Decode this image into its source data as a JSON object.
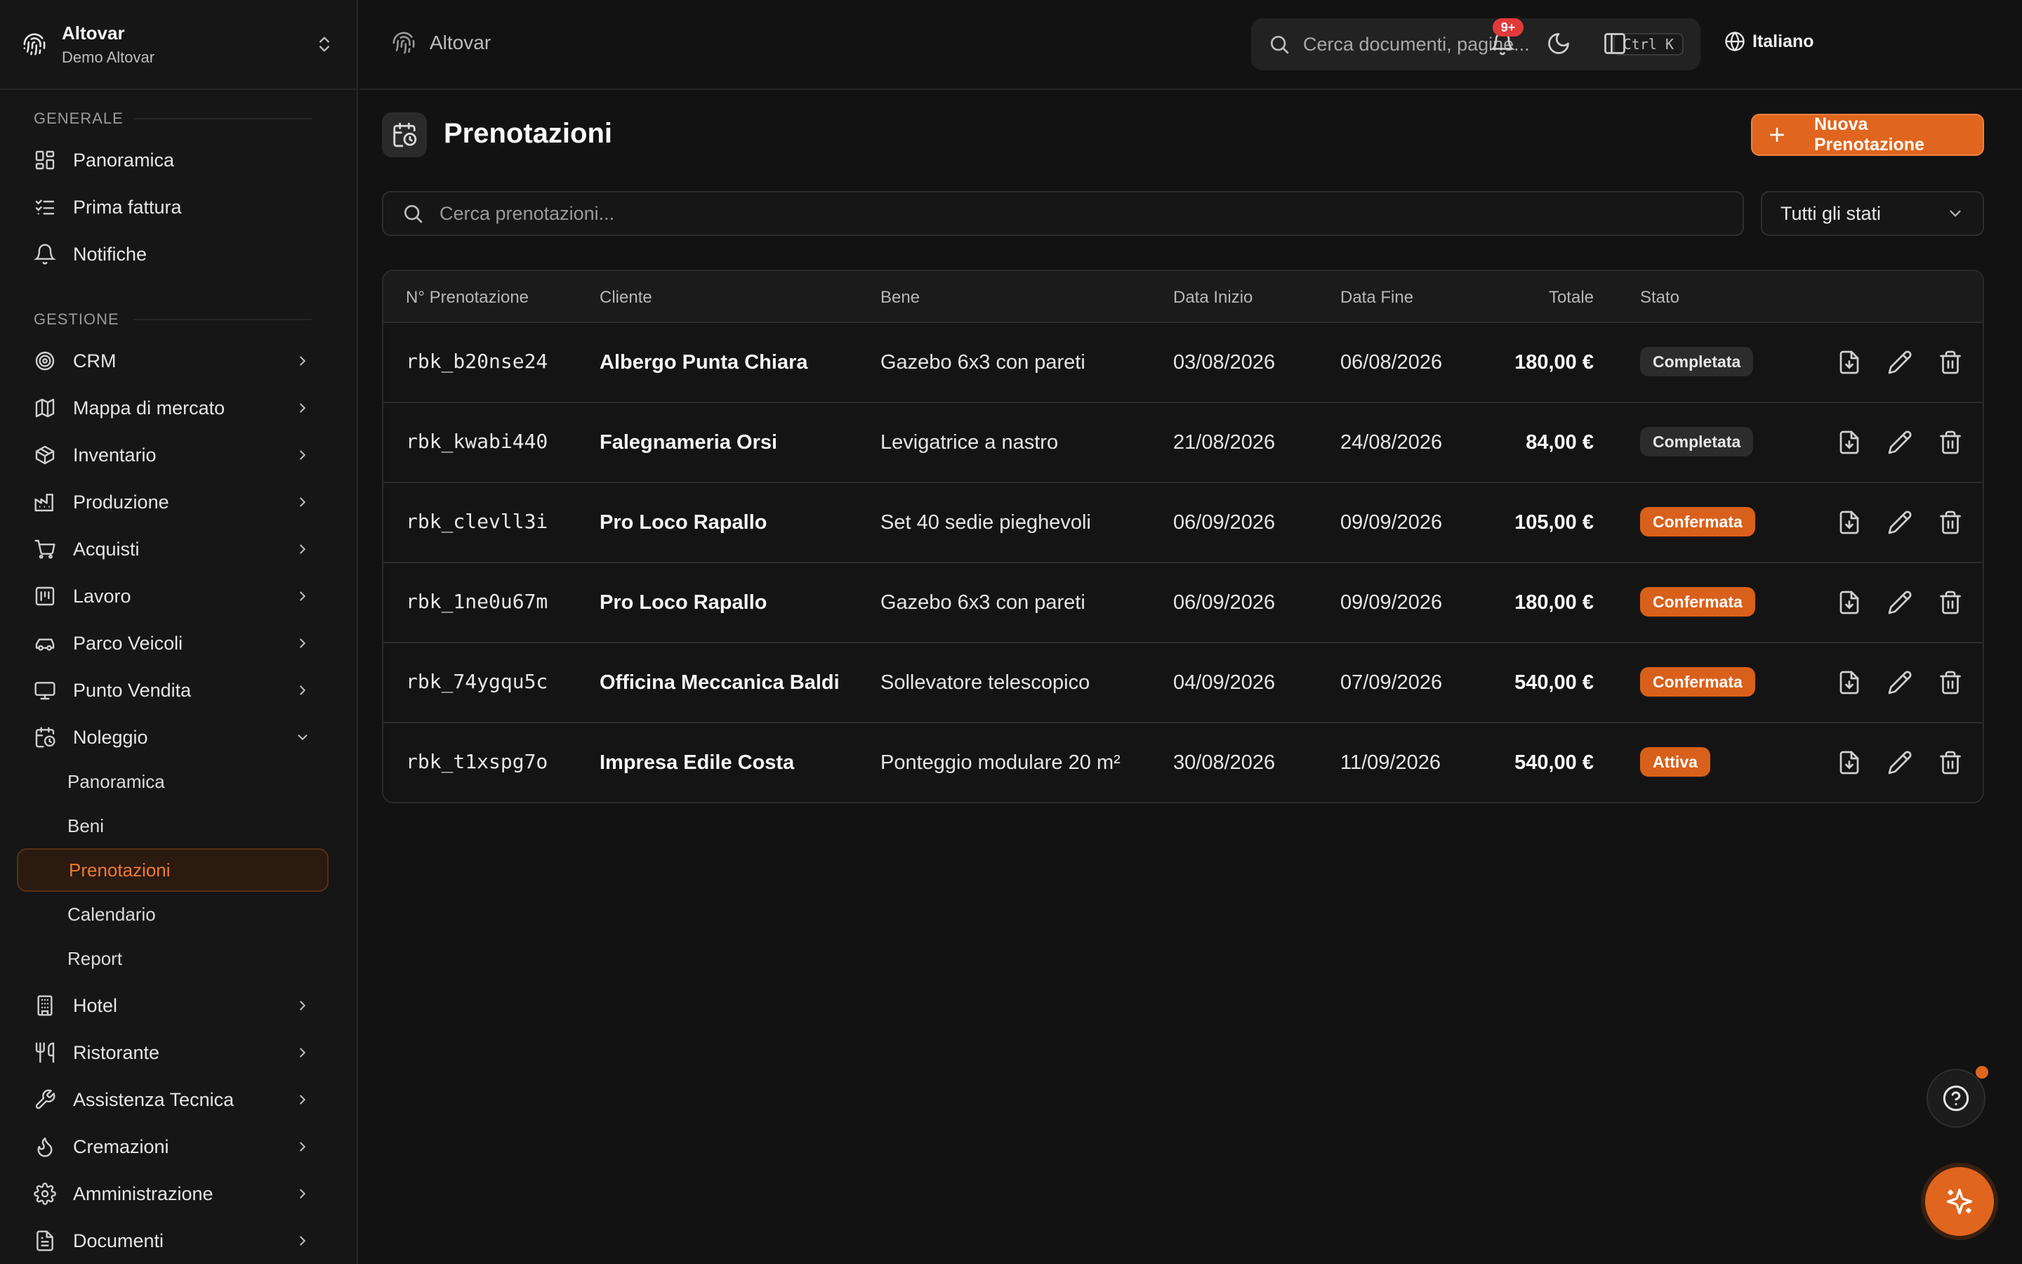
{
  "org": {
    "name": "Altovar",
    "subtitle": "Demo Altovar"
  },
  "sidebar": {
    "section_general": "GENERALE",
    "general_items": [
      {
        "label": "Panoramica",
        "icon": "dashboard-icon"
      },
      {
        "label": "Prima fattura",
        "icon": "checklist-icon"
      },
      {
        "label": "Notifiche",
        "icon": "bell-icon"
      }
    ],
    "section_management": "GESTIONE",
    "management_items": [
      {
        "label": "CRM",
        "icon": "target-icon"
      },
      {
        "label": "Mappa di mercato",
        "icon": "map-icon"
      },
      {
        "label": "Inventario",
        "icon": "package-icon"
      },
      {
        "label": "Produzione",
        "icon": "factory-icon"
      },
      {
        "label": "Acquisti",
        "icon": "cart-icon"
      },
      {
        "label": "Lavoro",
        "icon": "calendar-grid-icon"
      },
      {
        "label": "Parco Veicoli",
        "icon": "car-icon"
      },
      {
        "label": "Punto Vendita",
        "icon": "monitor-icon"
      },
      {
        "label": "Noleggio",
        "icon": "calendar-clock-icon"
      }
    ],
    "rental_sub_items": [
      {
        "label": "Panoramica"
      },
      {
        "label": "Beni"
      },
      {
        "label": "Prenotazioni"
      },
      {
        "label": "Calendario"
      },
      {
        "label": "Report"
      }
    ],
    "more_items": [
      {
        "label": "Hotel",
        "icon": "building-icon"
      },
      {
        "label": "Ristorante",
        "icon": "utensils-icon"
      },
      {
        "label": "Assistenza Tecnica",
        "icon": "wrench-icon"
      },
      {
        "label": "Cremazioni",
        "icon": "flame-icon"
      },
      {
        "label": "Amministrazione",
        "icon": "gear-icon"
      },
      {
        "label": "Documenti",
        "icon": "document-icon"
      }
    ]
  },
  "header": {
    "breadcrumb": "Altovar",
    "search_placeholder": "Cerca documenti, pagine...",
    "shortcut": "Ctrl K",
    "language": "Italiano",
    "notification_badge": "9+"
  },
  "page": {
    "title": "Prenotazioni",
    "new_button": "Nuova Prenotazione",
    "search_placeholder": "Cerca prenotazioni...",
    "status_filter": "Tutti gli stati"
  },
  "table": {
    "columns": [
      "N° Prenotazione",
      "Cliente",
      "Bene",
      "Data Inizio",
      "Data Fine",
      "Totale",
      "Stato"
    ],
    "rows": [
      {
        "code": "rbk_b20nse24",
        "client": "Albergo Punta Chiara",
        "item": "Gazebo 6x3 con pareti",
        "start": "03/08/2026",
        "end": "06/08/2026",
        "total": "180,00 €",
        "status": "Completata",
        "tone": "neutral"
      },
      {
        "code": "rbk_kwabi440",
        "client": "Falegnameria Orsi",
        "item": "Levigatrice a nastro",
        "start": "21/08/2026",
        "end": "24/08/2026",
        "total": "84,00 €",
        "status": "Completata",
        "tone": "neutral"
      },
      {
        "code": "rbk_clevll3i",
        "client": "Pro Loco Rapallo",
        "item": "Set 40 sedie pieghevoli",
        "start": "06/09/2026",
        "end": "09/09/2026",
        "total": "105,00 €",
        "status": "Confermata",
        "tone": "orange"
      },
      {
        "code": "rbk_1ne0u67m",
        "client": "Pro Loco Rapallo",
        "item": "Gazebo 6x3 con pareti",
        "start": "06/09/2026",
        "end": "09/09/2026",
        "total": "180,00 €",
        "status": "Confermata",
        "tone": "orange"
      },
      {
        "code": "rbk_74ygqu5c",
        "client": "Officina Meccanica Baldi",
        "item": "Sollevatore telescopico",
        "start": "04/09/2026",
        "end": "07/09/2026",
        "total": "540,00 €",
        "status": "Confermata",
        "tone": "orange"
      },
      {
        "code": "rbk_t1xspg7o",
        "client": "Impresa Edile Costa",
        "item": "Ponteggio modulare 20 m²",
        "start": "30/08/2026",
        "end": "11/09/2026",
        "total": "540,00 €",
        "status": "Attiva",
        "tone": "orange"
      }
    ]
  },
  "colors": {
    "accent": "#e0651e",
    "background": "#121212",
    "badge": "#e03a3a"
  }
}
